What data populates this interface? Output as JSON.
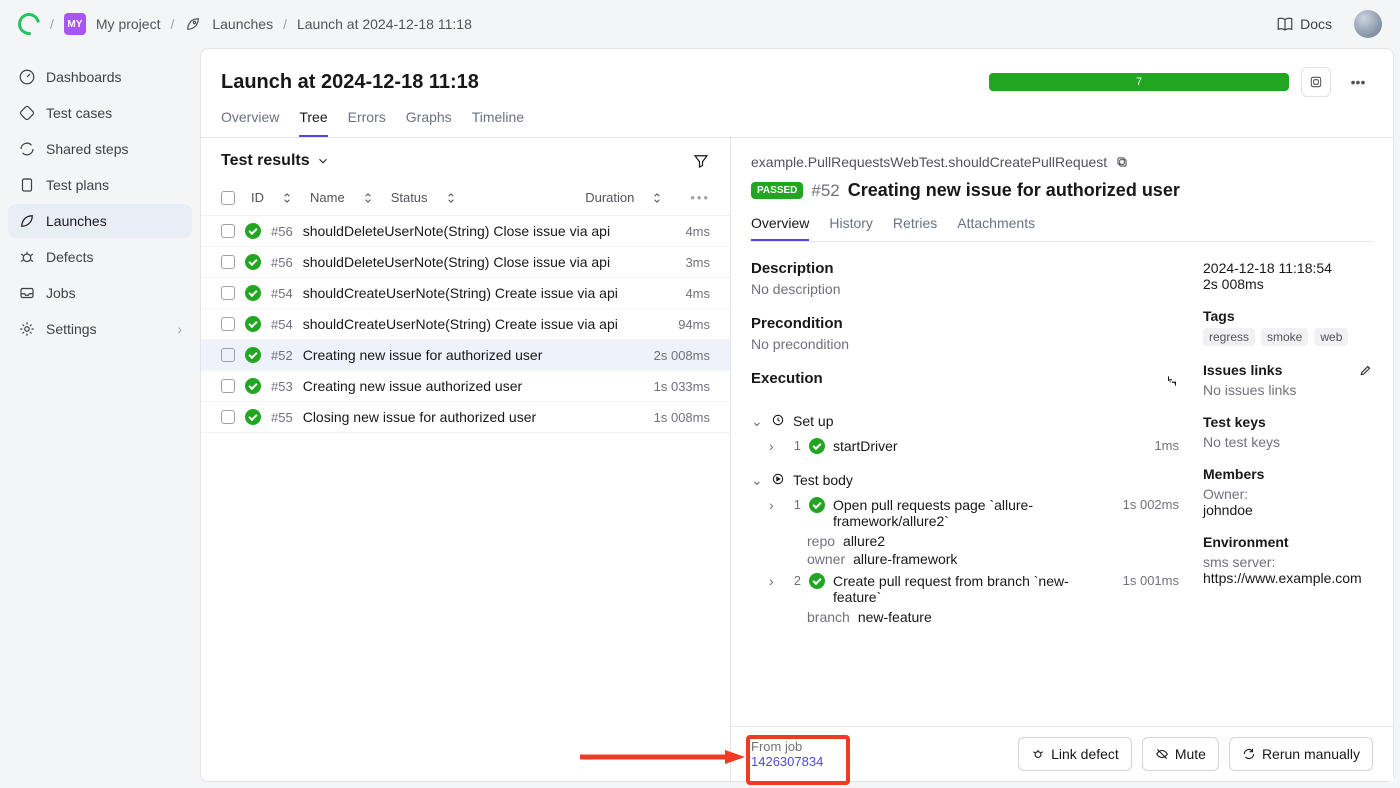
{
  "breadcrumb": {
    "project_abbr": "MY",
    "project": "My project",
    "section": "Launches",
    "current": "Launch at 2024-12-18 11:18"
  },
  "docs": "Docs",
  "sidebar": [
    {
      "label": "Dashboards"
    },
    {
      "label": "Test cases"
    },
    {
      "label": "Shared steps"
    },
    {
      "label": "Test plans"
    },
    {
      "label": "Launches"
    },
    {
      "label": "Defects"
    },
    {
      "label": "Jobs"
    },
    {
      "label": "Settings"
    }
  ],
  "launch": {
    "title": "Launch at 2024-12-18 11:18",
    "progress_count": "7"
  },
  "main_tabs": [
    "Overview",
    "Tree",
    "Errors",
    "Graphs",
    "Timeline"
  ],
  "results": {
    "heading": "Test results",
    "columns": {
      "id": "ID",
      "name": "Name",
      "status": "Status",
      "duration": "Duration"
    },
    "rows": [
      {
        "id": "#56",
        "name": "shouldDeleteUserNote(String) Close issue via api",
        "duration": "4ms"
      },
      {
        "id": "#56",
        "name": "shouldDeleteUserNote(String) Close issue via api",
        "duration": "3ms"
      },
      {
        "id": "#54",
        "name": "shouldCreateUserNote(String) Create issue via api",
        "duration": "4ms"
      },
      {
        "id": "#54",
        "name": "shouldCreateUserNote(String) Create issue via api",
        "duration": "94ms"
      },
      {
        "id": "#52",
        "name": "Creating new issue for authorized user",
        "duration": "2s 008ms",
        "selected": true
      },
      {
        "id": "#53",
        "name": "Creating new issue authorized user",
        "duration": "1s 033ms"
      },
      {
        "id": "#55",
        "name": "Closing new issue for authorized user",
        "duration": "1s 008ms"
      }
    ]
  },
  "detail": {
    "fqn": "example.PullRequestsWebTest.shouldCreatePullRequest",
    "status": "PASSED",
    "id": "#52",
    "title": "Creating new issue for authorized user",
    "tabs": [
      "Overview",
      "History",
      "Retries",
      "Attachments"
    ],
    "description": {
      "heading": "Description",
      "value": "No description"
    },
    "precondition": {
      "heading": "Precondition",
      "value": "No precondition"
    },
    "execution": {
      "heading": "Execution",
      "setup_label": "Set up",
      "setup": [
        {
          "n": "1",
          "text": "startDriver",
          "time": "1ms"
        }
      ],
      "body_label": "Test body",
      "body": [
        {
          "n": "1",
          "text": "Open pull requests page `allure-framework/allure2`",
          "time": "1s 002ms",
          "params": [
            {
              "k": "repo",
              "v": "allure2"
            },
            {
              "k": "owner",
              "v": "allure-framework"
            }
          ]
        },
        {
          "n": "2",
          "text": "Create pull request from branch `new-feature`",
          "time": "1s 001ms",
          "params": [
            {
              "k": "branch",
              "v": "new-feature"
            }
          ]
        }
      ]
    },
    "meta": {
      "timestamp": "2024-12-18 11:18:54",
      "duration": "2s 008ms",
      "tags_heading": "Tags",
      "tags": [
        "regress",
        "smoke",
        "web"
      ],
      "issues_heading": "Issues links",
      "issues_empty": "No issues links",
      "keys_heading": "Test keys",
      "keys_empty": "No test keys",
      "members_heading": "Members",
      "owner_label": "Owner:",
      "owner": "johndoe",
      "env_heading": "Environment",
      "env_label": "sms server:",
      "env_value": "https://www.example.com"
    },
    "from_job": {
      "label": "From job",
      "id": "1426307834"
    },
    "actions": {
      "link_defect": "Link defect",
      "mute": "Mute",
      "rerun": "Rerun manually"
    }
  }
}
